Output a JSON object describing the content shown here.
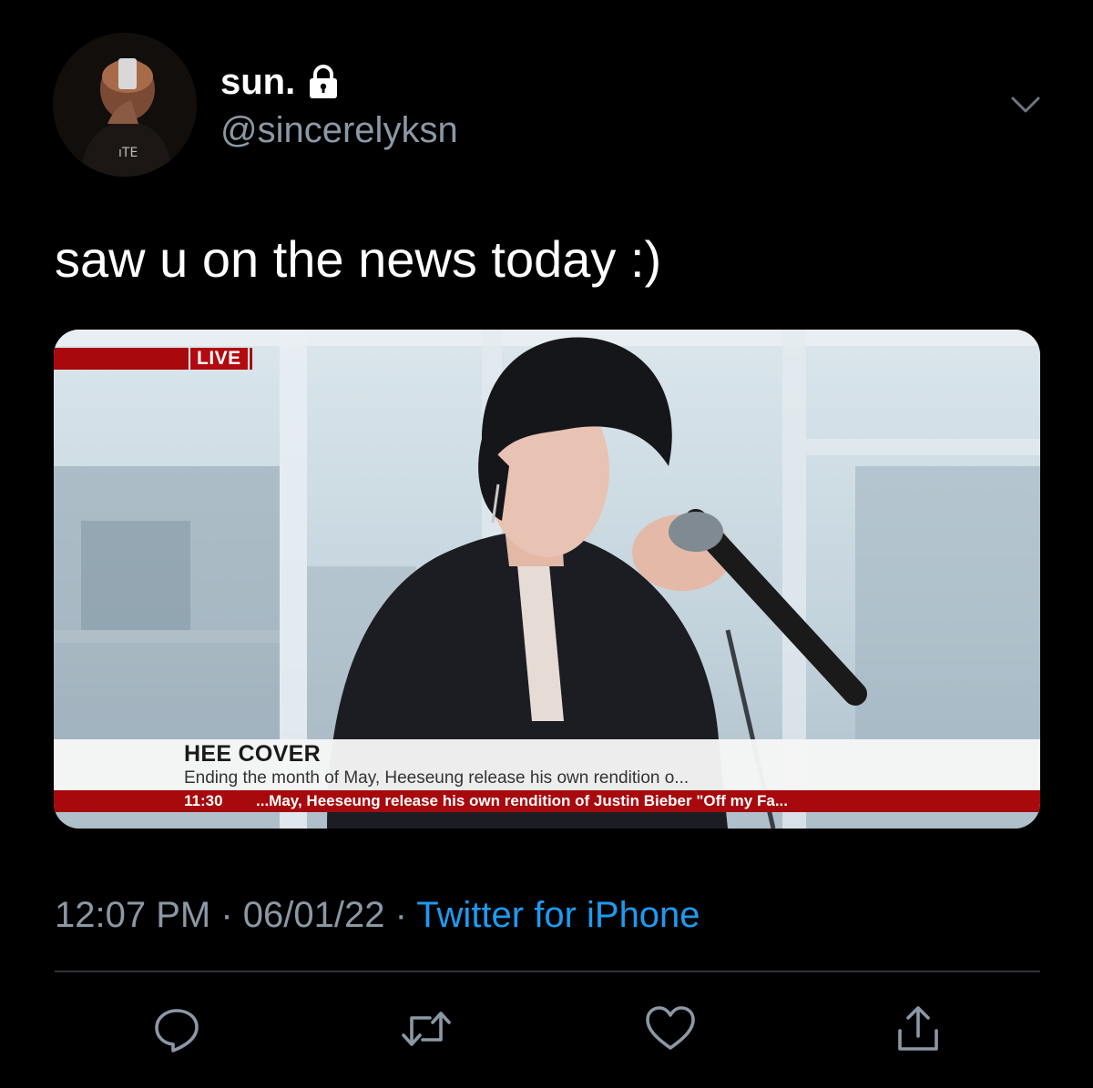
{
  "user": {
    "display_name": "sun.",
    "handle": "@sincerelyksn",
    "protected_icon": "lock-icon"
  },
  "tweet": {
    "text": "saw u on the news today :)"
  },
  "media": {
    "live_label": "LIVE",
    "headline": "HEE COVER",
    "subline": "Ending the month of May, Heeseung release his own rendition o...",
    "ticker_time": "11:30",
    "ticker_text": "...May, Heeseung release his own rendition of Justin Bieber \"Off my Fa...",
    "banner_color": "#a7090d"
  },
  "meta": {
    "time": "12:07 PM",
    "separator": " · ",
    "date": "06/01/22",
    "source": "Twitter for iPhone"
  },
  "actions": {
    "reply_icon": "reply-icon",
    "retweet_icon": "retweet-icon",
    "like_icon": "heart-icon",
    "share_icon": "share-icon"
  },
  "colors": {
    "background": "#000000",
    "secondary_text": "#8b98a5",
    "link": "#1d9bf0",
    "divider": "#2f3336"
  }
}
